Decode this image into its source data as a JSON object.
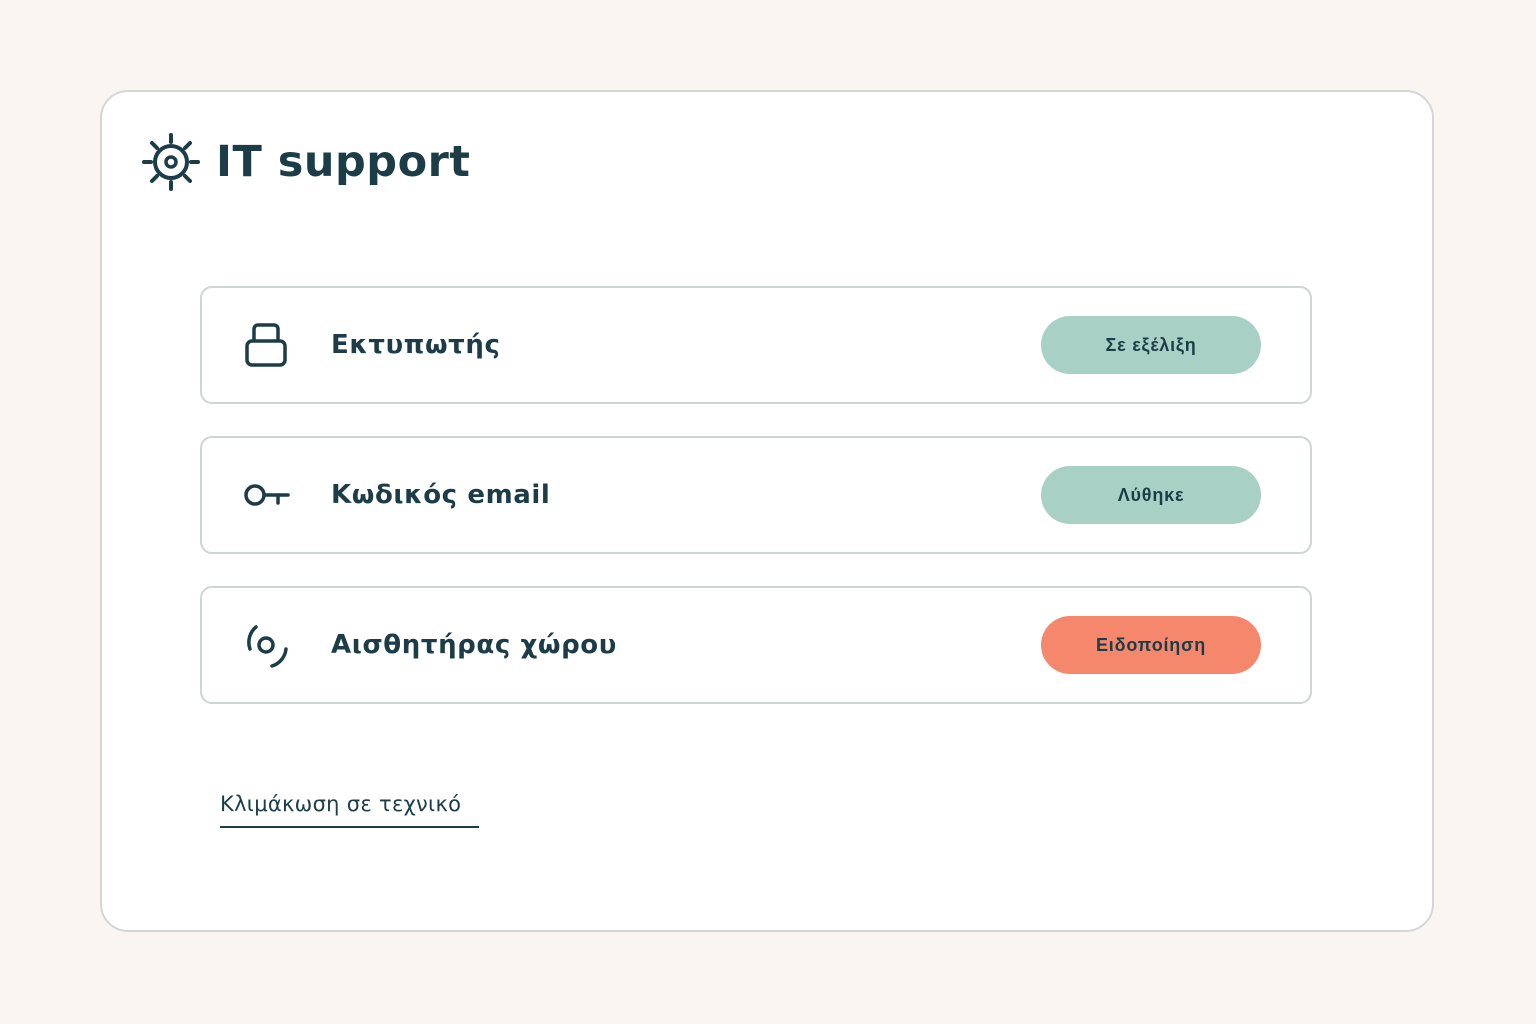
{
  "header": {
    "title": "IT support",
    "icon": "gear-icon"
  },
  "tickets": [
    {
      "label": "Εκτυπωτής",
      "icon": "printer-icon",
      "status": "Σε εξέλιξη",
      "status_color": "#a8d0c4"
    },
    {
      "label": "Κωδικός email",
      "icon": "key-icon",
      "status": "Λύθηκε",
      "status_color": "#a8d0c4"
    },
    {
      "label": "Αισθητήρας χώρου",
      "icon": "sensor-icon",
      "status": "Ειδοποίηση",
      "status_color": "#f5876c"
    }
  ],
  "escalate_link": "Κλιμάκωση σε τεχνικό",
  "colors": {
    "background": "#f9f6f1",
    "card": "#ffffff",
    "text": "#1c3d47",
    "border": "#d4d6d6"
  }
}
